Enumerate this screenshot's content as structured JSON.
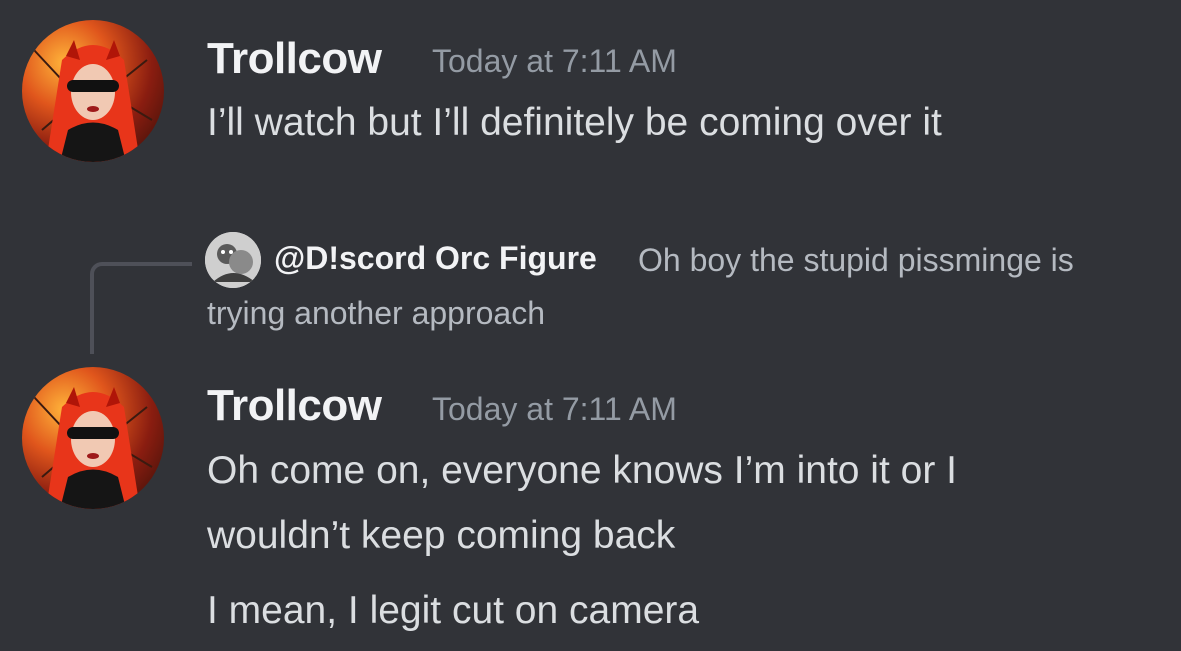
{
  "messages": [
    {
      "author": "Trollcow",
      "timestamp": "Today at 7:11 AM",
      "avatar_icon": "user-avatar",
      "lines": [
        "I’ll watch but I’ll definitely be coming over it"
      ]
    },
    {
      "reply_to": {
        "author": "@D!scord Orc Figure",
        "avatar_icon": "user-avatar",
        "text_line1": "Oh boy the stupid pissminge is",
        "text_line2": "trying another approach"
      },
      "author": "Trollcow",
      "timestamp": "Today at 7:11 AM",
      "avatar_icon": "user-avatar",
      "lines": [
        "Oh come on, everyone knows I’m into it or I",
        "wouldn’t keep coming back",
        "I mean, I legit cut on camera"
      ]
    }
  ],
  "colors": {
    "background": "#313338",
    "author": "#f2f3f5",
    "timestamp": "#949ba4",
    "message_text": "#dbdee1",
    "reply_text": "#b5bac1",
    "reply_spine": "#4e5058"
  }
}
